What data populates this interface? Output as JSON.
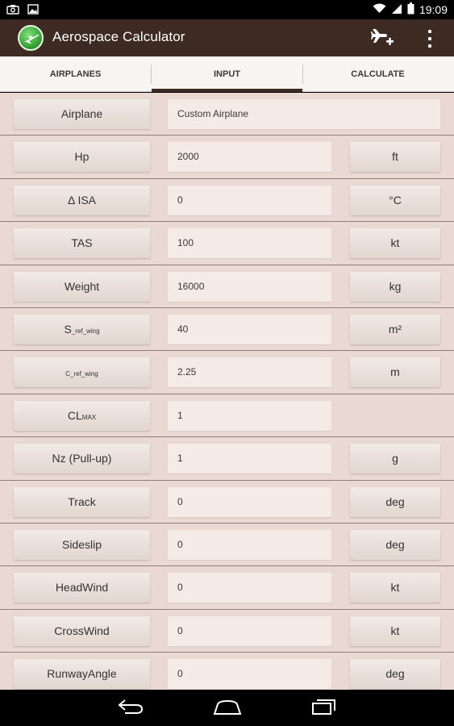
{
  "status_bar": {
    "time": "19:09"
  },
  "app": {
    "title": "Aerospace Calculator"
  },
  "tabs": [
    {
      "label": "AIRPLANES"
    },
    {
      "label": "INPUT"
    },
    {
      "label": "CALCULATE"
    }
  ],
  "form": {
    "rows": [
      {
        "label": "Airplane",
        "value": "Custom Airplane",
        "unit": ""
      },
      {
        "label": "Hp",
        "value": "2000",
        "unit": "ft"
      },
      {
        "label": "Δ ISA",
        "value": "0",
        "unit": "°C"
      },
      {
        "label": "TAS",
        "value": "100",
        "unit": "kt"
      },
      {
        "label": "Weight",
        "value": "16000",
        "unit": "kg"
      },
      {
        "label_main": "S",
        "label_sub": "_ref_wing",
        "value": "40",
        "unit": "m²"
      },
      {
        "label_main": "C",
        "label_sub": "_ref_wing",
        "value": "2.25",
        "unit": "m"
      },
      {
        "label_main": "CL",
        "label_sub": "MAX",
        "value": "1",
        "unit": ""
      },
      {
        "label": "Nz (Pull-up)",
        "value": "1",
        "unit": "g"
      },
      {
        "label": "Track",
        "value": "0",
        "unit": "deg"
      },
      {
        "label": "Sideslip",
        "value": "0",
        "unit": "deg"
      },
      {
        "label": "HeadWind",
        "value": "0",
        "unit": "kt"
      },
      {
        "label": "CrossWind",
        "value": "0",
        "unit": "kt"
      },
      {
        "label": "RunwayAngle",
        "value": "0",
        "unit": "deg"
      }
    ]
  },
  "colors": {
    "action_bar": "#3d2a22",
    "form_background": "#ead9d3",
    "logo_green": "#2f9a2c"
  }
}
